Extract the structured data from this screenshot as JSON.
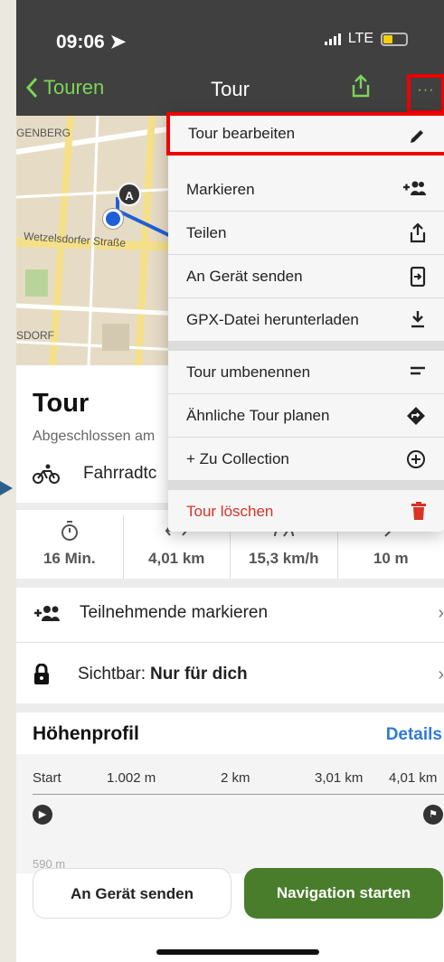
{
  "status": {
    "time": "09:06",
    "network": "LTE"
  },
  "nav": {
    "back_label": "Touren",
    "title": "Tour",
    "more_label": "···"
  },
  "map": {
    "labels": [
      "GENBERG",
      "Wetzelsdorfer Straße",
      "SDORF"
    ],
    "marker": "A"
  },
  "tour": {
    "title": "Tour",
    "subtitle": "Abgeschlossen am",
    "sport": "Fahrradtc"
  },
  "stats": [
    {
      "icon": "stopwatch-icon",
      "value": "16 Min."
    },
    {
      "icon": "distance-icon",
      "value": "4,01 km"
    },
    {
      "icon": "speed-icon",
      "value": "15,3 km/h"
    },
    {
      "icon": "elevation-icon",
      "value": "10 m"
    }
  ],
  "rows": {
    "participants": "Teilnehmende markieren",
    "visibility_prefix": "Sichtbar: ",
    "visibility_value": "Nur für dich"
  },
  "profile": {
    "title": "Höhenprofil",
    "details": "Details",
    "ticks": [
      "Start",
      "1.002 m",
      "2 km",
      "3,01 km",
      "4,01 km"
    ],
    "ylabel": "590 m"
  },
  "buttons": {
    "send": "An Gerät senden",
    "navigate": "Navigation starten"
  },
  "menu": {
    "items": [
      "Tour bearbeiten",
      "Markieren",
      "Teilen",
      "An Gerät senden",
      "GPX-Datei herunterladen",
      "Tour umbenennen",
      "Ähnliche Tour planen",
      "+ Zu Collection",
      "Tour löschen"
    ]
  },
  "colors": {
    "accent": "#7bd657",
    "primary_button": "#4a7d2b",
    "danger": "#d93325",
    "highlight": "#e00000"
  }
}
